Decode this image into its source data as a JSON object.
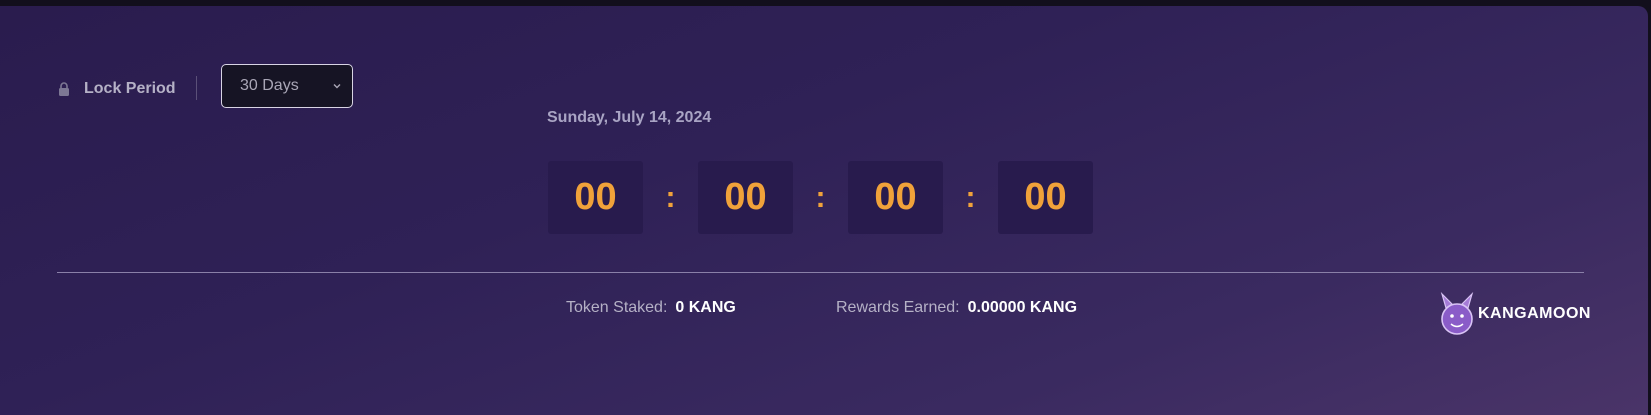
{
  "lock": {
    "label": "Lock Period",
    "icon": "lock-icon"
  },
  "select": {
    "value": "30 Days",
    "icon": "chevron-down-icon"
  },
  "countdown": {
    "date": "Sunday, July 14, 2024",
    "units": [
      "00",
      "00",
      "00",
      "00"
    ],
    "separator": ":"
  },
  "stats": {
    "staked": {
      "label": "Token Staked:",
      "value": "0 KANG"
    },
    "rewards": {
      "label": "Rewards Earned:",
      "value": "0.00000 KANG"
    }
  },
  "logo": {
    "text": "KANGAMOON",
    "icon": "kangaroo-logo-icon"
  },
  "colors": {
    "accent": "#f0a23a",
    "box_bg": "#281b4d",
    "card_bg": "#2f2156"
  }
}
